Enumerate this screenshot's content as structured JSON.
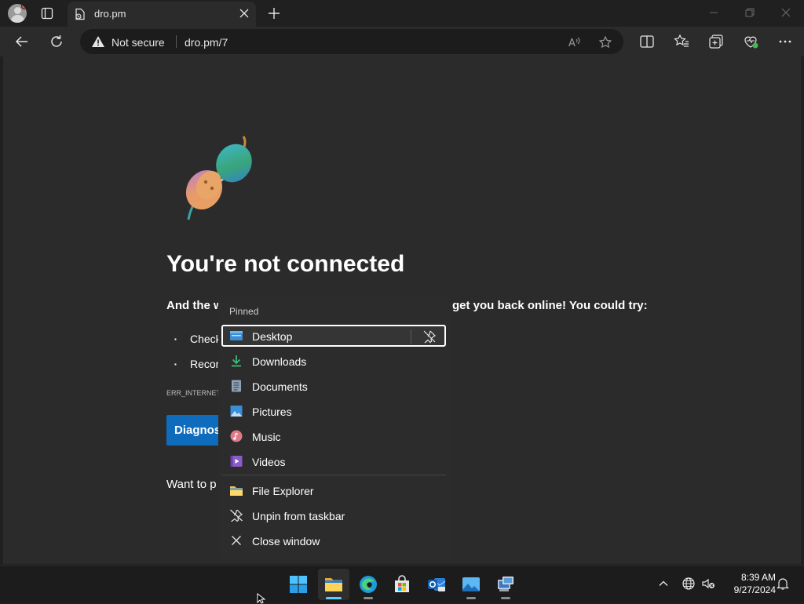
{
  "browser": {
    "tab_title": "dro.pm",
    "security_label": "Not secure",
    "url": "dro.pm/7"
  },
  "page": {
    "heading": "You're not connected",
    "subtext_left": "And the w",
    "subtext_right": "get you back online! You could try:",
    "bullets": [
      "Check",
      "Recor"
    ],
    "error_code": "ERR_INTERNET",
    "diagnose_button": "Diagnos",
    "want_to": "Want to p"
  },
  "jumplist": {
    "header": "Pinned",
    "pinned": [
      {
        "label": "Desktop",
        "icon": "desktop-folder-icon"
      },
      {
        "label": "Downloads",
        "icon": "downloads-icon"
      },
      {
        "label": "Documents",
        "icon": "documents-icon"
      },
      {
        "label": "Pictures",
        "icon": "pictures-icon"
      },
      {
        "label": "Music",
        "icon": "music-icon"
      },
      {
        "label": "Videos",
        "icon": "videos-icon"
      }
    ],
    "actions": [
      {
        "label": "File Explorer",
        "icon": "file-explorer-icon"
      },
      {
        "label": "Unpin from taskbar",
        "icon": "unpin-icon"
      },
      {
        "label": "Close window",
        "icon": "close-icon"
      }
    ]
  },
  "taskbar": {
    "apps": [
      "start-icon",
      "file-explorer-icon",
      "edge-icon",
      "store-icon",
      "outlook-icon",
      "photos-icon",
      "remote-desktop-icon"
    ],
    "time": "8:39 AM",
    "date": "9/27/2024"
  },
  "colors": {
    "accent": "#0f6cbd",
    "active_indicator": "#60cdff"
  }
}
